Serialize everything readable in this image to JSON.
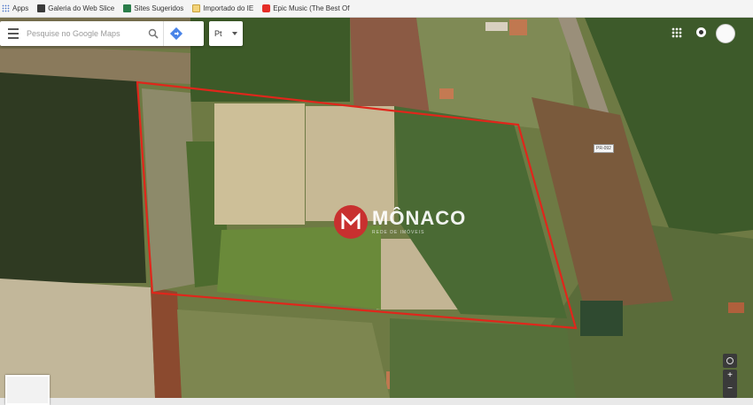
{
  "bookmarks": [
    {
      "label": "Apps",
      "icon": "apps-icon"
    },
    {
      "label": "Galeria do Web Slice",
      "icon": "web-slice-icon"
    },
    {
      "label": "Sites Sugeridos",
      "icon": "suggested-sites-icon"
    },
    {
      "label": "Importado do IE",
      "icon": "folder-icon"
    },
    {
      "label": "Epic Music (The Best Of",
      "icon": "youtube-icon"
    }
  ],
  "search": {
    "placeholder": "Pesquise no Google Maps"
  },
  "language": {
    "value": "Pt"
  },
  "watermark": {
    "name": "MÔNACO",
    "tagline": "REDE DE IMÓVEIS"
  },
  "map": {
    "road_label": "PR-092",
    "building_label": "",
    "zoom_in": "+",
    "zoom_out": "−",
    "boundary_color": "#e0261b"
  }
}
